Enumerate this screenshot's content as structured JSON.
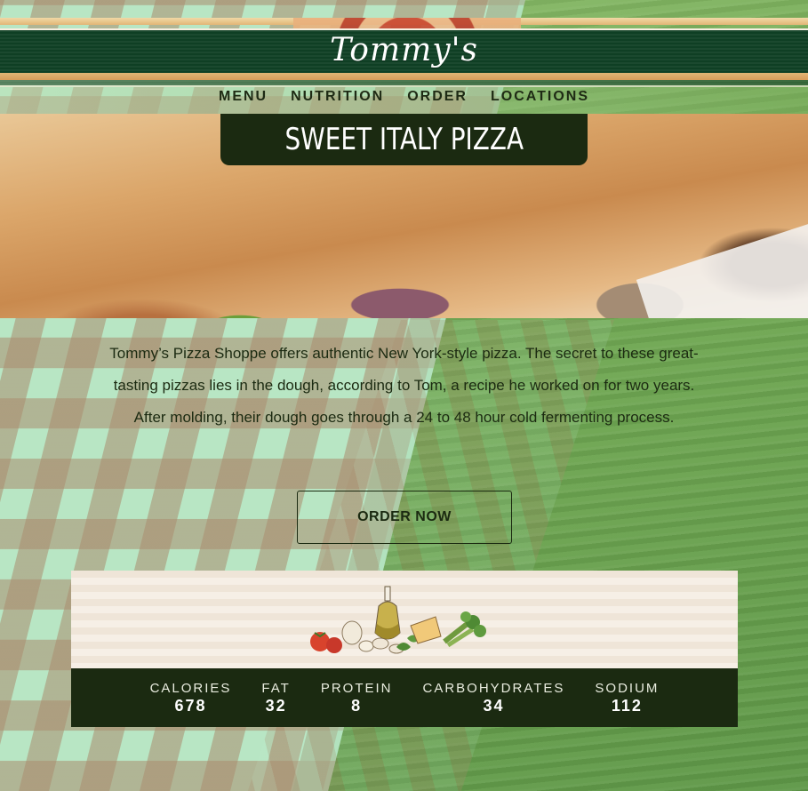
{
  "header": {
    "logo_text": "Tommy's"
  },
  "nav": {
    "items": [
      {
        "label": "MENU"
      },
      {
        "label": "NUTRITION"
      },
      {
        "label": "ORDER"
      },
      {
        "label": "LOCATIONS"
      }
    ]
  },
  "hero": {
    "title": "SWEET ITALY PIZZA"
  },
  "description": "Tommy’s Pizza Shoppe offers authentic New York-style pizza. The secret to these great-tasting pizzas lies in the dough, according to Tom, a recipe he worked on for two years. After molding, their dough goes through a 24 to 48 hour cold fermenting process.",
  "order_button": "ORDER NOW",
  "nutrition": {
    "facts": [
      {
        "label": "CALORIES",
        "value": "678"
      },
      {
        "label": "FAT",
        "value": "32"
      },
      {
        "label": "PROTEIN",
        "value": "8"
      },
      {
        "label": "CARBOHYDRATES",
        "value": "34"
      },
      {
        "label": "SODIUM",
        "value": "112"
      }
    ]
  },
  "colors": {
    "header_green": "#0f3f24",
    "dark_panel": "#1b2a11",
    "text_dark": "#1b2a11",
    "panel_cream": "#efe5d8"
  }
}
